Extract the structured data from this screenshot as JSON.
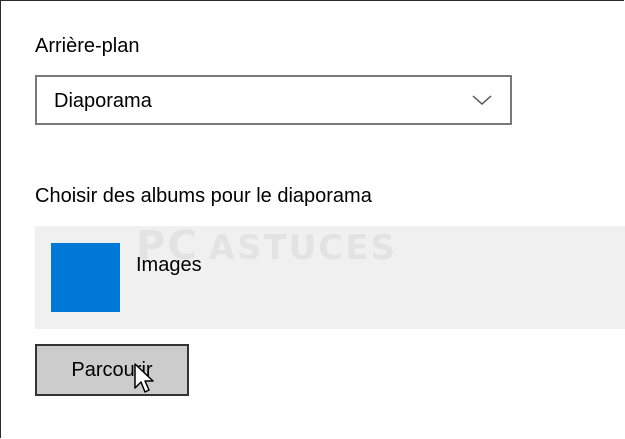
{
  "background": {
    "label": "Arrière-plan",
    "dropdown": {
      "selected": "Diaporama",
      "icon": "chevron-down-icon"
    }
  },
  "albums": {
    "label": "Choisir des albums pour le diaporama",
    "items": [
      {
        "name": "Images",
        "color": "#0078d7"
      }
    ]
  },
  "browse_button": {
    "label": "Parcourir"
  },
  "watermark": {
    "big": "PC",
    "small": "ASTUCES"
  },
  "cursor": {
    "icon": "pointer-cursor-icon"
  },
  "colors": {
    "accent": "#0078d7",
    "panel": "#f0f0f0",
    "button": "#cccccc",
    "dropdown_border": "#7a7a7a"
  }
}
